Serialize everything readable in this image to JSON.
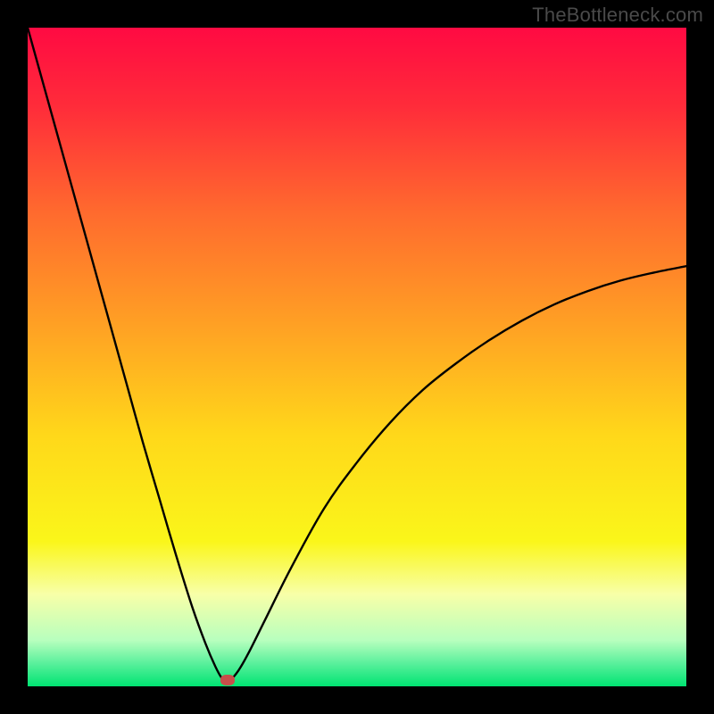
{
  "watermark": "TheBottleneck.com",
  "chart_data": {
    "type": "line",
    "title": "",
    "xlabel": "",
    "ylabel": "",
    "xlim": [
      0,
      100
    ],
    "ylim": [
      0,
      100
    ],
    "grid": false,
    "legend": false,
    "background_gradient": {
      "stops": [
        {
          "pos": 0.0,
          "color": "#ff0a42"
        },
        {
          "pos": 0.12,
          "color": "#ff2c3a"
        },
        {
          "pos": 0.28,
          "color": "#ff6a2e"
        },
        {
          "pos": 0.45,
          "color": "#ffa024"
        },
        {
          "pos": 0.62,
          "color": "#ffd81a"
        },
        {
          "pos": 0.78,
          "color": "#faf61a"
        },
        {
          "pos": 0.86,
          "color": "#f8ffa8"
        },
        {
          "pos": 0.93,
          "color": "#b8ffbe"
        },
        {
          "pos": 0.965,
          "color": "#5af09c"
        },
        {
          "pos": 1.0,
          "color": "#00e472"
        }
      ]
    },
    "series": [
      {
        "name": "bottleneck-curve",
        "color": "#000000",
        "x": [
          0.0,
          2.5,
          5.0,
          7.5,
          10.0,
          12.5,
          15.0,
          17.5,
          20.0,
          22.5,
          25.0,
          27.0,
          28.5,
          29.5,
          30.0,
          30.7,
          32.0,
          33.5,
          36.0,
          40.0,
          45.0,
          50.0,
          55.0,
          60.0,
          65.0,
          70.0,
          75.0,
          80.0,
          85.0,
          90.0,
          95.0,
          100.0
        ],
        "y": [
          100.0,
          91.0,
          82.0,
          73.0,
          64.0,
          55.0,
          46.0,
          37.0,
          28.5,
          20.0,
          12.0,
          6.5,
          3.0,
          1.2,
          0.9,
          0.9,
          2.4,
          5.0,
          10.0,
          18.0,
          27.0,
          34.0,
          40.0,
          45.0,
          49.0,
          52.5,
          55.5,
          58.0,
          60.0,
          61.6,
          62.8,
          63.8
        ]
      }
    ],
    "marker": {
      "x": 30.4,
      "y": 0.9,
      "color": "#c74f4a"
    }
  }
}
